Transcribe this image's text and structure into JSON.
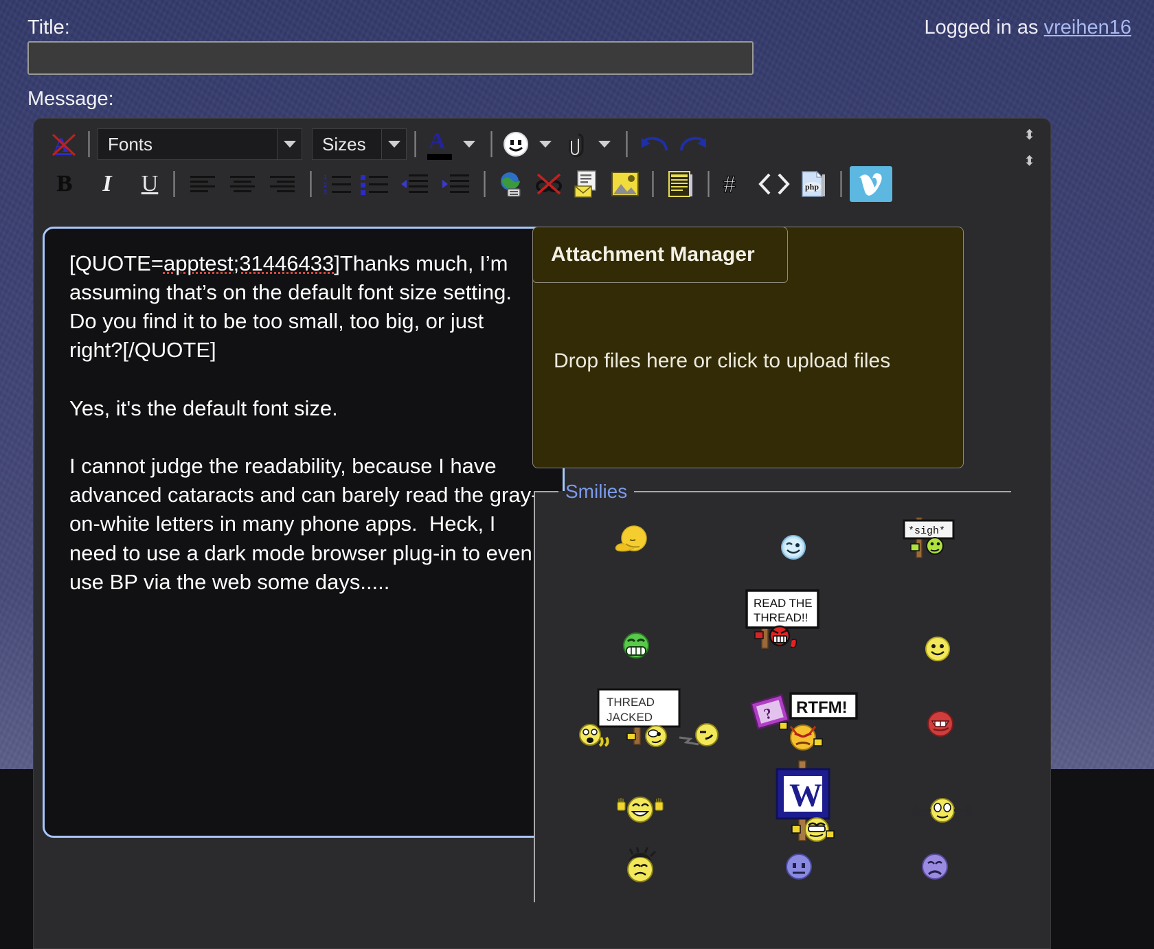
{
  "header": {
    "title_label": "Title:",
    "title_value": "",
    "title_placeholder": "",
    "logged_in_prefix": "Logged in as ",
    "username": "vreihen16",
    "message_label": "Message:"
  },
  "toolbar": {
    "row1": [
      {
        "name": "remove-formatting-icon",
        "label": "remove-formatting"
      },
      {
        "name": "fonts-select",
        "label": "Fonts"
      },
      {
        "name": "sizes-select",
        "label": "Sizes"
      },
      {
        "name": "font-color-icon",
        "label": "font-color",
        "color": "#000000"
      },
      {
        "name": "smilie-icon",
        "label": "insert-smilie"
      },
      {
        "name": "attachment-icon",
        "label": "insert-attachment"
      },
      {
        "name": "undo-icon",
        "label": "undo"
      },
      {
        "name": "redo-icon",
        "label": "redo"
      }
    ],
    "row2": [
      {
        "name": "bold-button",
        "label": "B"
      },
      {
        "name": "italic-button",
        "label": "I"
      },
      {
        "name": "underline-button",
        "label": "U"
      },
      {
        "name": "align-left-button",
        "label": "align-left"
      },
      {
        "name": "align-center-button",
        "label": "align-center"
      },
      {
        "name": "align-right-button",
        "label": "align-right"
      },
      {
        "name": "ordered-list-button",
        "label": "ordered-list"
      },
      {
        "name": "unordered-list-button",
        "label": "unordered-list"
      },
      {
        "name": "outdent-button",
        "label": "outdent"
      },
      {
        "name": "indent-button",
        "label": "indent"
      },
      {
        "name": "insert-link-button",
        "label": "insert-link"
      },
      {
        "name": "unlink-button",
        "label": "unlink"
      },
      {
        "name": "insert-email-button",
        "label": "insert-email"
      },
      {
        "name": "insert-image-button",
        "label": "insert-image"
      },
      {
        "name": "insert-quote-button",
        "label": "insert-quote"
      },
      {
        "name": "insert-hash-button",
        "label": "insert-hash"
      },
      {
        "name": "insert-code-button",
        "label": "insert-code"
      },
      {
        "name": "insert-php-button",
        "label": "insert-php"
      },
      {
        "name": "insert-video-button",
        "label": "insert-video"
      }
    ],
    "fonts_label": "Fonts",
    "sizes_label": "Sizes"
  },
  "message": {
    "quote_open": "[QUOTE=",
    "quote_ref": "apptest;31446433",
    "quote_close": "]",
    "body_line1": "Thanks much, I’m assuming that’s on the default font size setting.  Do you find it to be too small, too big, or just right?[/QUOTE]",
    "body_line2": "Yes, it's the default font size.",
    "body_line3": "I cannot judge the readability, because I have advanced cataracts and can barely read the gray-on-white letters in many phone apps.  Heck, I need to use a dark mode browser plug-in to even use BP via the web some days....."
  },
  "attachments": {
    "header_label": "Attachment Manager",
    "drop_label": "Drop files here or click to upload files"
  },
  "smilies": {
    "legend": "Smilies",
    "items": [
      {
        "name": "smiley-facepalm",
        "alt": "facepalm"
      },
      {
        "name": "smiley-blue-wink",
        "alt": "blue-wink"
      },
      {
        "name": "smiley-sigh-sign",
        "alt": "sigh-sign"
      },
      {
        "name": "smiley-green-grin",
        "alt": "green-grin"
      },
      {
        "name": "smiley-read-the-thread-sign",
        "alt": "read-the-thread"
      },
      {
        "name": "smiley-plain-yellow",
        "alt": "plain-smile"
      },
      {
        "name": "smiley-thread-jacked-sign",
        "alt": "thread-jacked"
      },
      {
        "name": "smiley-rtfm-sign",
        "alt": "rtfm"
      },
      {
        "name": "smiley-red-angry",
        "alt": "red-angry"
      },
      {
        "name": "smiley-clap",
        "alt": "clap"
      },
      {
        "name": "smiley-welcome-sign",
        "alt": "welcome-w-sign"
      },
      {
        "name": "smiley-weight-lift",
        "alt": "weight-lift"
      },
      {
        "name": "smiley-hair-pull",
        "alt": "hair-pull"
      },
      {
        "name": "smiley-blue-sad",
        "alt": "blue-sad"
      },
      {
        "name": "smiley-purple-sad",
        "alt": "purple-sad"
      }
    ]
  },
  "colors": {
    "page_bg": "#474a78",
    "editor_bg": "#2b2b2e",
    "msgbox_bg": "#111113",
    "msgbox_border": "#a8c7fa",
    "attach_bg": "#332b05",
    "link": "#aab8f0",
    "legend": "#7b9aea"
  }
}
